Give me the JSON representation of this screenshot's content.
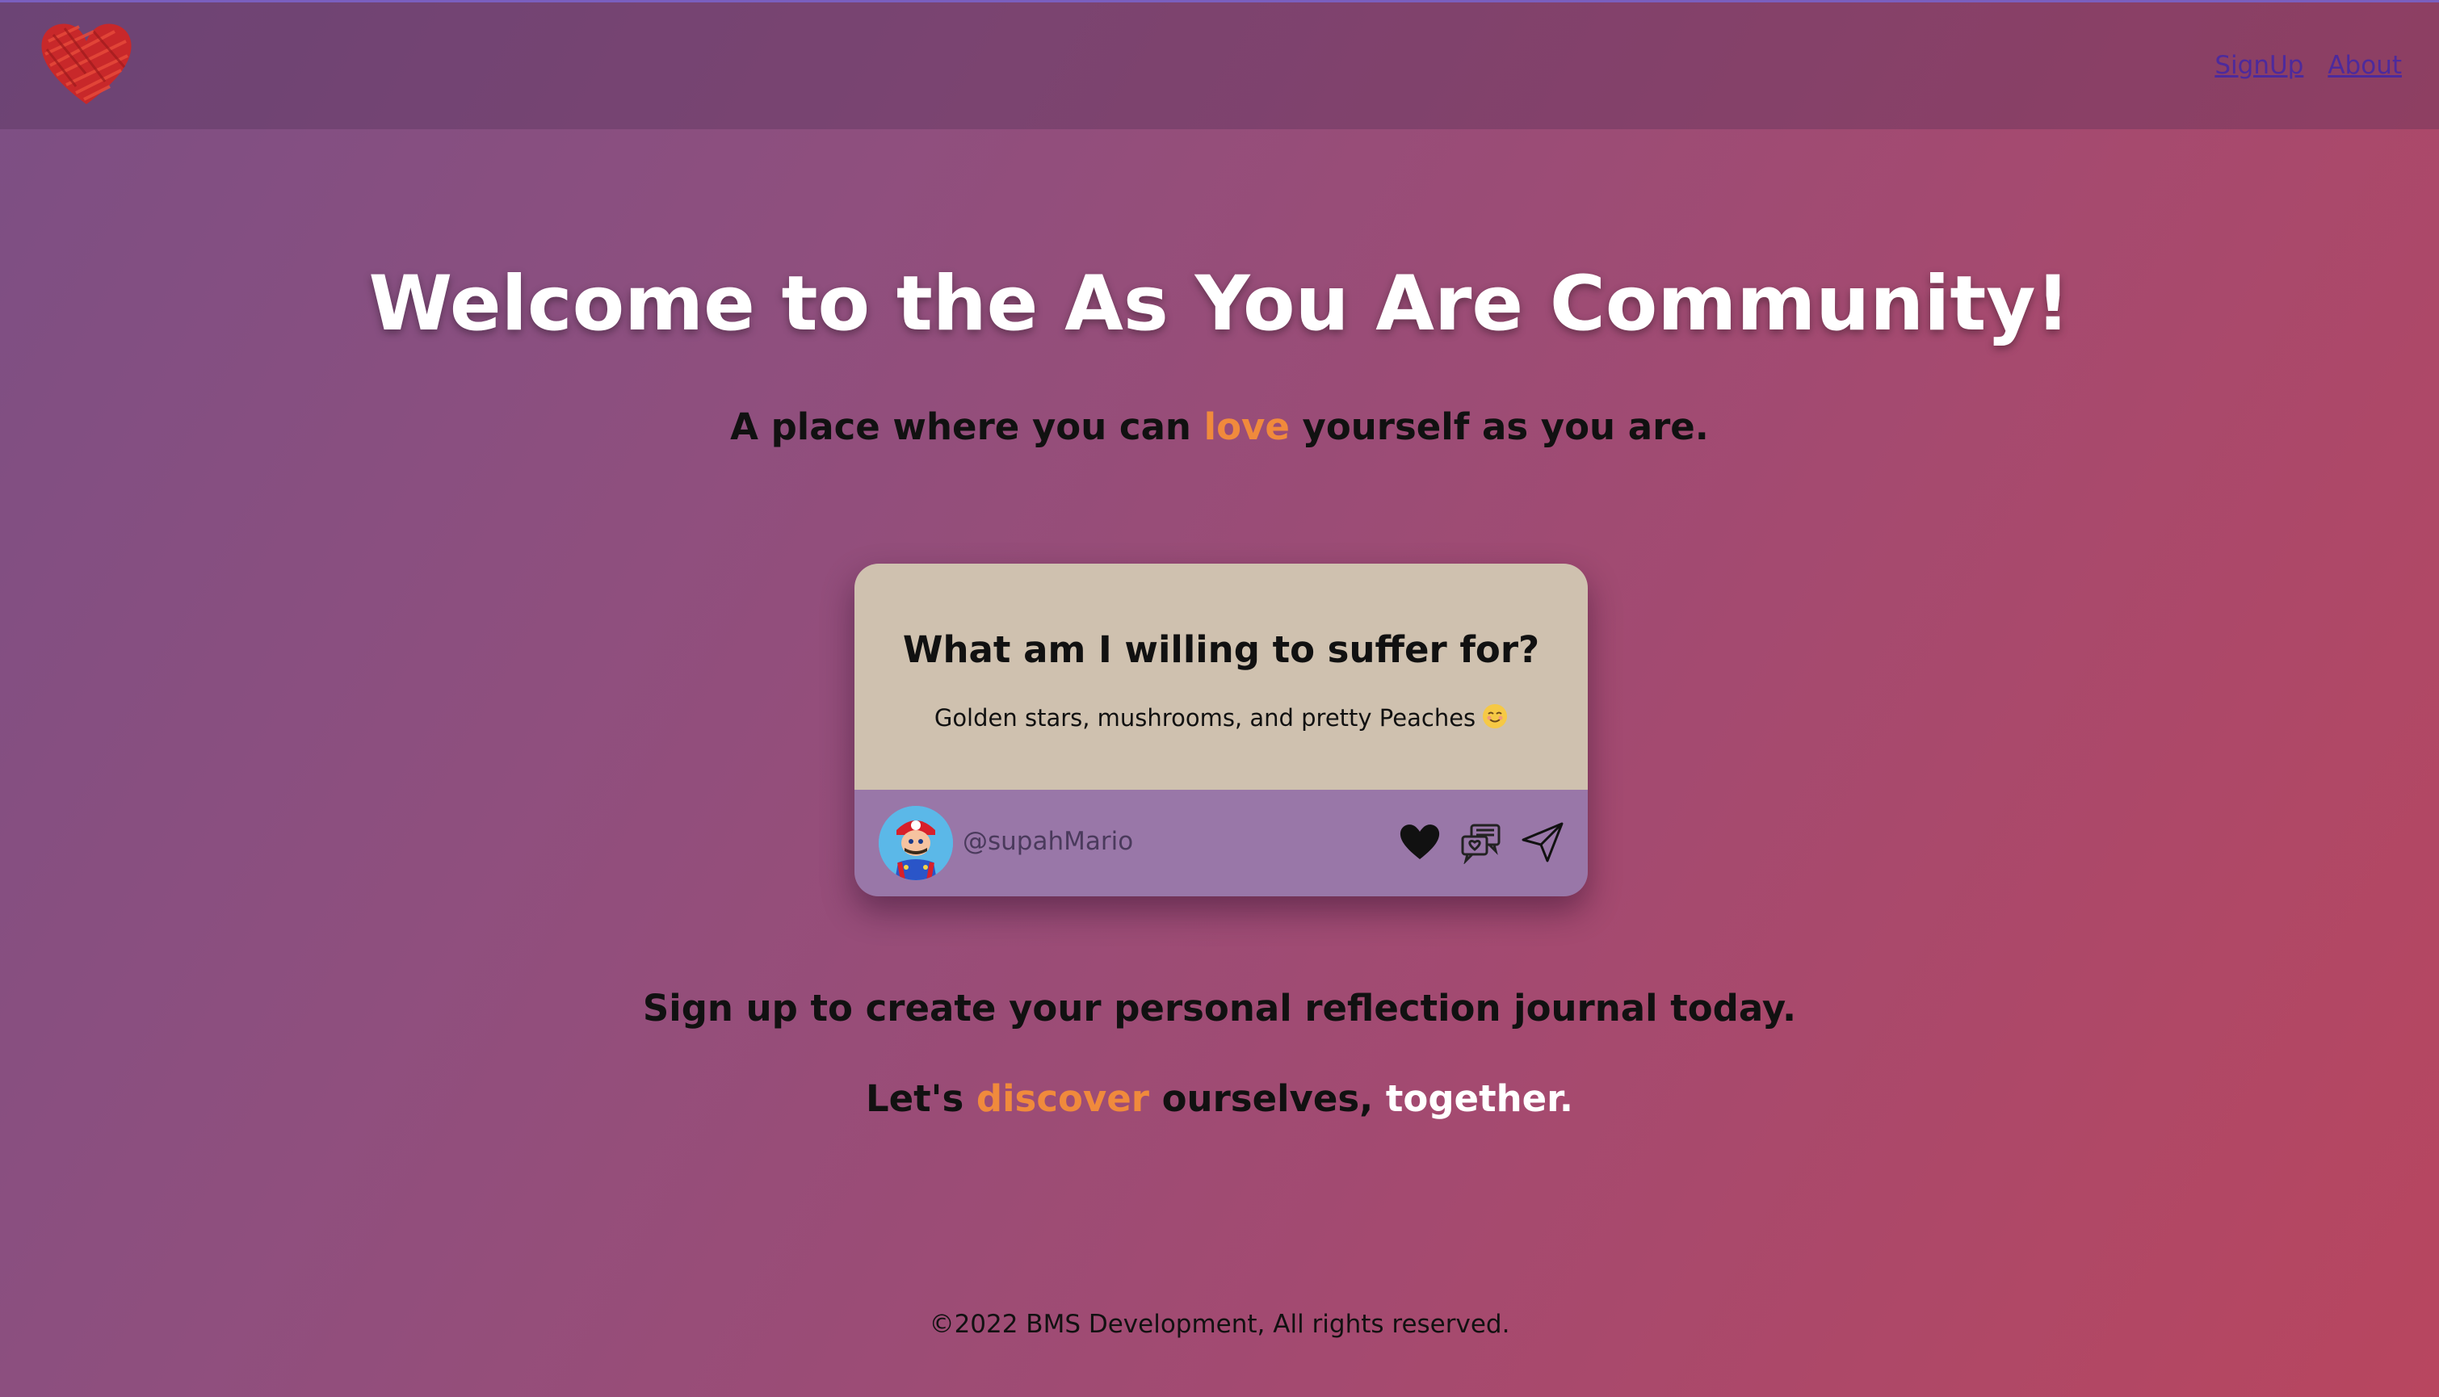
{
  "nav": {
    "logo_icon": "scribbled-heart-icon",
    "links": [
      {
        "label": "SignUp"
      },
      {
        "label": "About"
      }
    ]
  },
  "hero": {
    "title": "Welcome to the As You Are Community!",
    "tagline_pre": "A place where you can ",
    "tagline_accent": "love",
    "tagline_post": " yourself as you are."
  },
  "card": {
    "question": "What am I willing to suffer for?",
    "answer": "Golden stars, mushrooms, and pretty Peaches",
    "answer_emoji": "smiling-face-emoji",
    "username": "@supahMario",
    "avatar_icon": "mario-avatar",
    "actions": [
      "heart-icon",
      "comments-icon",
      "send-icon"
    ]
  },
  "cta": {
    "signup_text": "Sign up to create your personal reflection journal today.",
    "discover_pre": "Let's ",
    "discover_accent": "discover",
    "discover_mid": " ourselves, ",
    "discover_white": "together."
  },
  "footer": {
    "text": "©2022 BMS Development, All rights reserved."
  },
  "colors": {
    "accent": "#f08a3c",
    "link": "#4d2a9c",
    "card_body": "#cfc1af",
    "card_footer": "#9977a8",
    "logo_red": "#d42a2a"
  }
}
